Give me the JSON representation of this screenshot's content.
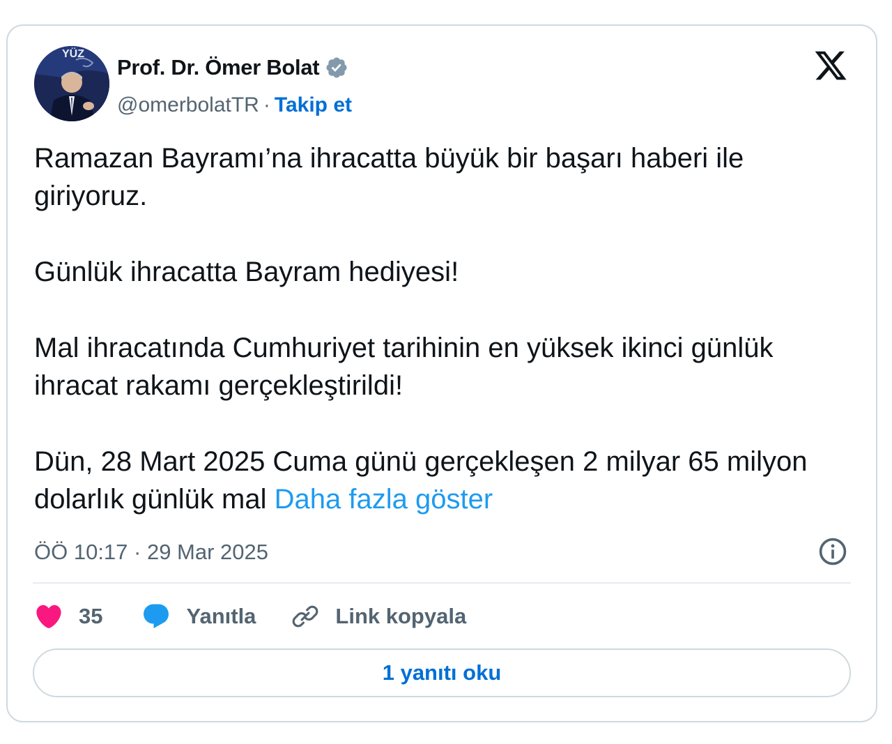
{
  "author": {
    "name": "Prof. Dr. Ömer Bolat",
    "handle": "@omerbolatTR",
    "separator": "·",
    "follow_label": "Takip et",
    "verified_color": "#829aab",
    "avatar_text": "YÜZ"
  },
  "tweet": {
    "paragraphs": [
      "Ramazan Bayramı’na ihracatta büyük bir başarı haberi ile giriyoruz.",
      "Günlük ihracatta Bayram hediyesi!",
      "Mal ihracatında Cumhuriyet tarihinin en yüksek ikinci günlük ihracat rakamı gerçekleştirildi!",
      "Dün, 28 Mart 2025 Cuma günü gerçekleşen 2 milyar 65 milyon dolarlık günlük mal"
    ],
    "show_more": "Daha fazla göster",
    "timestamp": "ÖÖ 10:17 · 29 Mar 2025"
  },
  "actions": {
    "like_count": "35",
    "reply_label": "Yanıtla",
    "copy_link_label": "Link kopyala"
  },
  "read_replies_label": "1 yanıtı oku",
  "colors": {
    "link": "#1d9bf0",
    "follow": "#006fd6",
    "heart": "#f91880",
    "reply_bubble": "#1d9bf0",
    "muted": "#536471",
    "border": "#cfd9de"
  },
  "icons": [
    "verified-badge-icon",
    "x-logo-icon",
    "info-icon",
    "heart-icon",
    "reply-bubble-icon",
    "link-icon"
  ]
}
